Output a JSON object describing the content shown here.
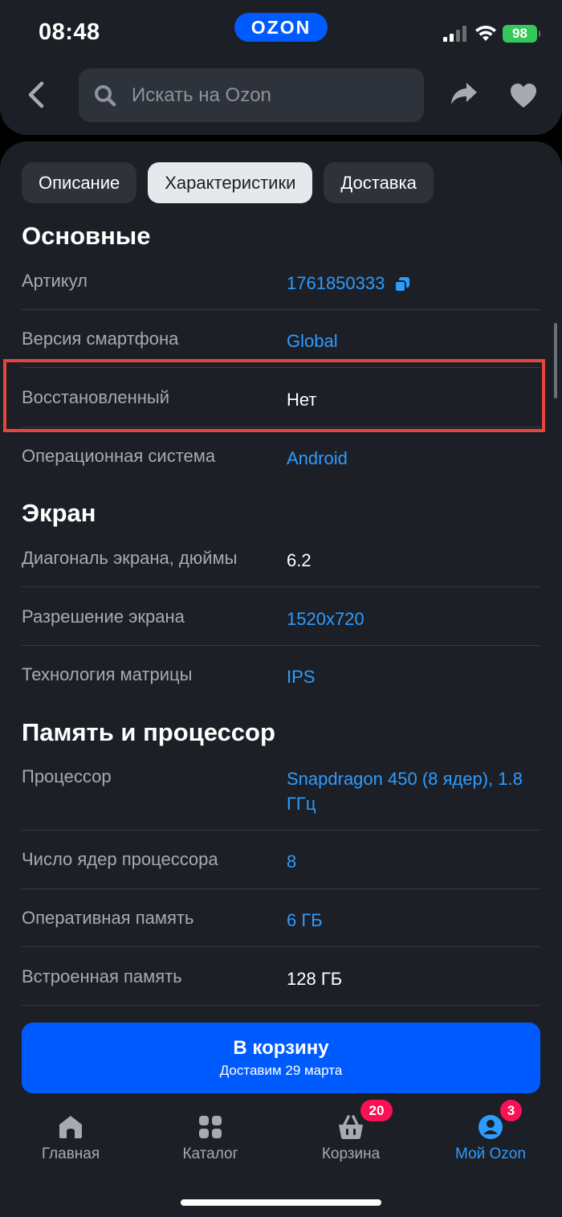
{
  "status": {
    "time": "08:48",
    "battery": "98"
  },
  "header": {
    "logo": "OZON",
    "search_placeholder": "Искать на Ozon"
  },
  "tabs": [
    {
      "label": "Описание",
      "active": false
    },
    {
      "label": "Характеристики",
      "active": true
    },
    {
      "label": "Доставка",
      "active": false
    }
  ],
  "sections": {
    "basic": {
      "title": "Основные",
      "rows": [
        {
          "label": "Артикул",
          "value": "1761850333"
        },
        {
          "label": "Версия смартфона",
          "value": "Global"
        },
        {
          "label": "Восстановленный",
          "value": "Нет"
        },
        {
          "label": "Операционная система",
          "value": "Android"
        }
      ]
    },
    "screen": {
      "title": "Экран",
      "rows": [
        {
          "label": "Диагональ экрана, дюймы",
          "value": "6.2"
        },
        {
          "label": "Разрешение экрана",
          "value": "1520x720"
        },
        {
          "label": "Технология матрицы",
          "value": "IPS"
        }
      ]
    },
    "memory": {
      "title": "Память и процессор",
      "rows": [
        {
          "label": "Процессор",
          "value": "Snapdragon 450 (8 ядер), 1.8 ГГц"
        },
        {
          "label": "Число ядер процессора",
          "value": "8"
        },
        {
          "label": "Оперативная память",
          "value": "6 ГБ"
        },
        {
          "label": "Встроенная память",
          "value": "128 ГБ"
        }
      ]
    }
  },
  "cart_button": {
    "title": "В корзину",
    "subtitle": "Доставим 29 марта"
  },
  "navbar": {
    "items": [
      {
        "label": "Главная"
      },
      {
        "label": "Каталог"
      },
      {
        "label": "Корзина",
        "badge": "20"
      },
      {
        "label": "Мой Ozon",
        "badge": "3",
        "active": true
      }
    ]
  },
  "colors": {
    "accent": "#005bff",
    "link": "#2d9cff",
    "badge": "#f91155",
    "highlight": "#e5453b",
    "background": "#1c1f26"
  }
}
